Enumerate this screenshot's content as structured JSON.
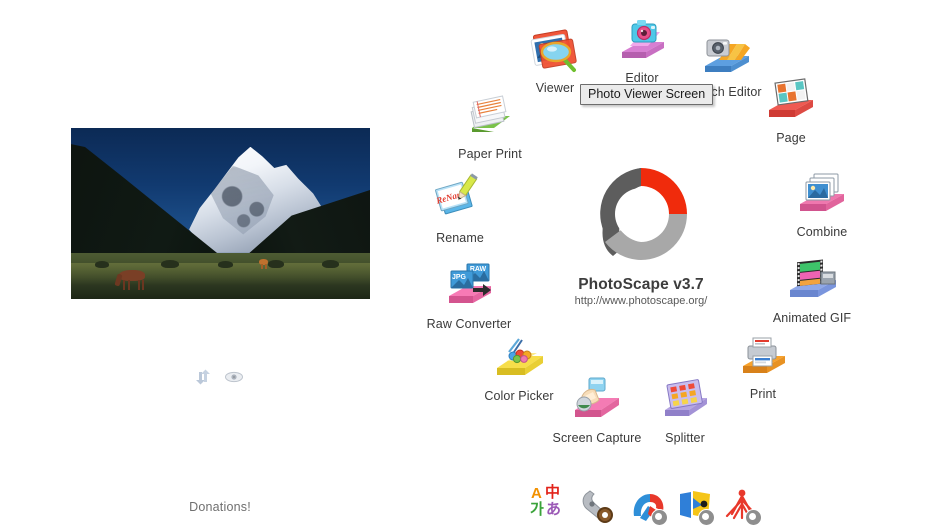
{
  "app": {
    "name": "PhotoScape",
    "version_title": "PhotoScape v3.7",
    "url": "http://www.photoscape.org/",
    "background": "#ffffff"
  },
  "tooltip": {
    "text": "Photo Viewer Screen",
    "bg": "#ebebeb",
    "border": "#6d6d6d"
  },
  "preview": {
    "alt": "Mountain landscape with horses grazing in a meadow",
    "donations_label": "Donations!",
    "mini_tools": [
      {
        "name": "refresh-icon",
        "title": "Refresh"
      },
      {
        "name": "eye-icon",
        "title": "Preview"
      }
    ]
  },
  "menu": {
    "items": [
      {
        "id": "viewer",
        "label": "Viewer",
        "icon": "viewer-icon"
      },
      {
        "id": "editor",
        "label": "Editor",
        "icon": "editor-icon"
      },
      {
        "id": "batch-editor",
        "label": "Batch Editor",
        "icon": "batch-editor-icon"
      },
      {
        "id": "page",
        "label": "Page",
        "icon": "page-icon"
      },
      {
        "id": "combine",
        "label": "Combine",
        "icon": "combine-icon"
      },
      {
        "id": "animated-gif",
        "label": "Animated GIF",
        "icon": "animated-gif-icon"
      },
      {
        "id": "print",
        "label": "Print",
        "icon": "print-icon"
      },
      {
        "id": "splitter",
        "label": "Splitter",
        "icon": "splitter-icon"
      },
      {
        "id": "screen-capture",
        "label": "Screen Capture",
        "icon": "screen-capture-icon"
      },
      {
        "id": "color-picker",
        "label": "Color Picker",
        "icon": "color-picker-icon"
      },
      {
        "id": "raw-converter",
        "label": "Raw Converter",
        "icon": "raw-converter-icon"
      },
      {
        "id": "rename",
        "label": "Rename",
        "icon": "rename-icon"
      },
      {
        "id": "paper-print",
        "label": "Paper Print",
        "icon": "paper-print-icon"
      }
    ]
  },
  "logo": {
    "colors": {
      "dark_gray": "#5d5d5d",
      "red": "#f02b0c",
      "light_gray": "#a8a8a8",
      "hole": "#ffffff"
    }
  },
  "bottom_bar": {
    "items": [
      {
        "id": "language",
        "name": "language-icon",
        "glyphs": [
          "A",
          "中",
          "가",
          "あ"
        ]
      },
      {
        "id": "settings",
        "name": "wrench-icon",
        "label": ""
      },
      {
        "id": "promo-1",
        "name": "promo-app-icon-1",
        "label": ""
      },
      {
        "id": "promo-2",
        "name": "promo-app-icon-2",
        "label": ""
      },
      {
        "id": "promo-3",
        "name": "promo-app-icon-3",
        "label": ""
      }
    ]
  }
}
